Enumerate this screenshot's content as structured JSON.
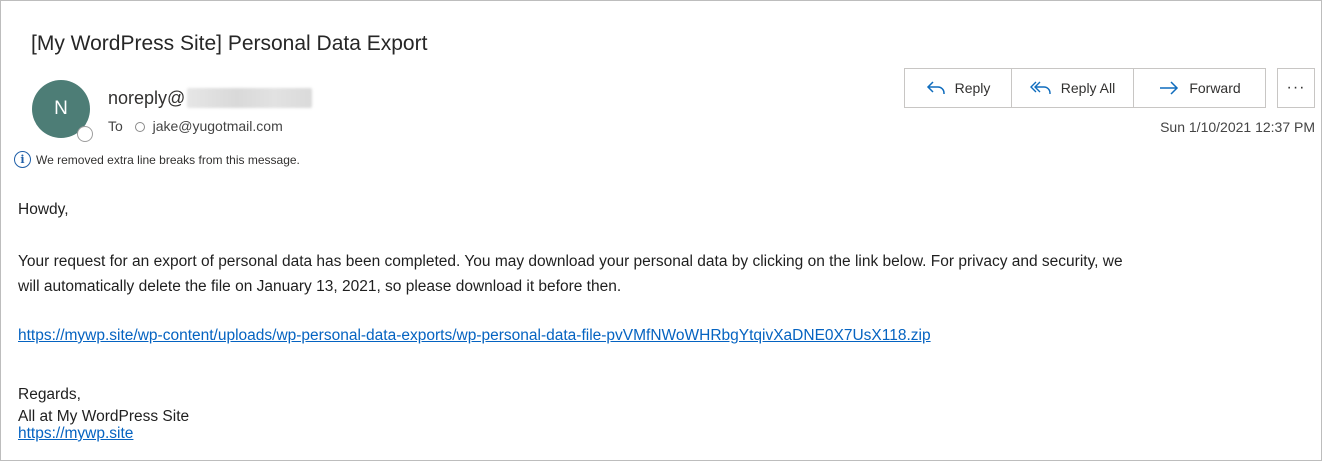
{
  "email": {
    "subject": "[My WordPress Site] Personal Data Export",
    "sender": {
      "avatar_initial": "N",
      "name_prefix": "noreply@"
    },
    "to": {
      "label": "To",
      "address": "jake@yugotmail.com"
    },
    "info_notice": "We removed extra line breaks from this message.",
    "timestamp": "Sun 1/10/2021 12:37 PM",
    "actions": {
      "reply_label": "Reply",
      "reply_all_label": "Reply All",
      "forward_label": "Forward",
      "more_label": "···"
    },
    "body": {
      "greeting": "Howdy,",
      "paragraph_line1": "Your request for an export of personal data has been completed. You may download your personal data by clicking on the link below. For privacy and security, we",
      "paragraph_line2": "will automatically delete the file on January 13, 2021, so please download it before then.",
      "export_link": "https://mywp.site/wp-content/uploads/wp-personal-data-exports/wp-personal-data-file-pvVMfNWoWHRbgYtqivXaDNE0X7UsX118.zip",
      "regards": "Regards,",
      "signature": "All at My WordPress Site",
      "site_link": "https://mywp.site"
    }
  },
  "icons": {
    "reply": "reply-arrow-icon",
    "reply_all": "reply-all-arrow-icon",
    "forward": "forward-arrow-icon",
    "info": "info-icon",
    "more": "more-ellipsis-icon"
  },
  "colors": {
    "avatar_bg": "#4d7d76",
    "accent": "#0f6cbd",
    "link": "#0563c1"
  }
}
